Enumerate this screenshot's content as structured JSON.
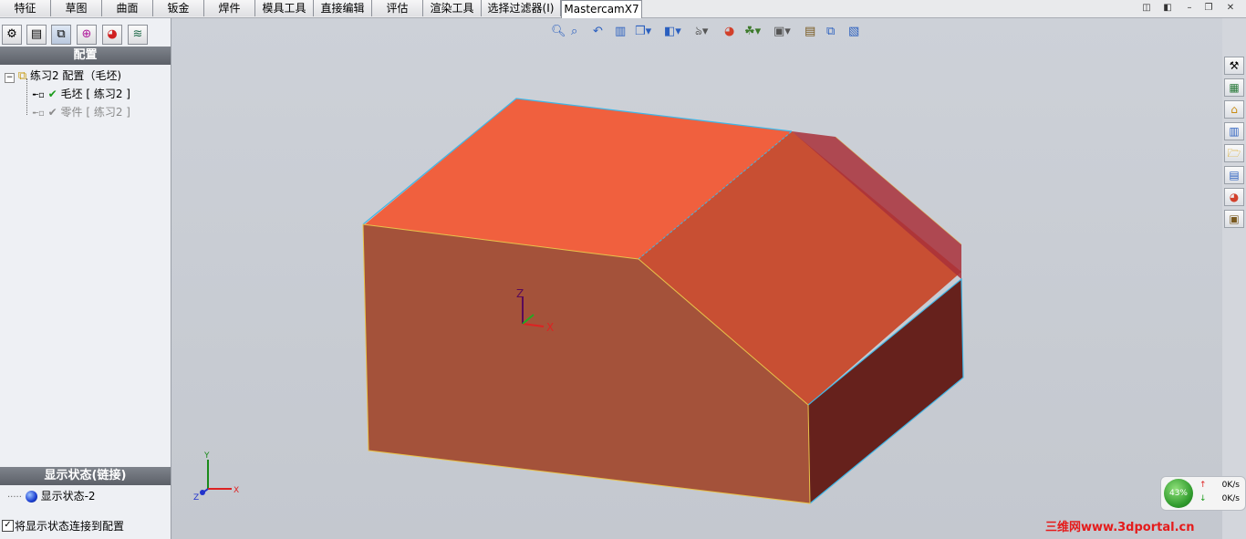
{
  "tabs": [
    {
      "label": "特征"
    },
    {
      "label": "草图"
    },
    {
      "label": "曲面"
    },
    {
      "label": "钣金"
    },
    {
      "label": "焊件"
    },
    {
      "label": "模具工具"
    },
    {
      "label": "直接编辑"
    },
    {
      "label": "评估"
    },
    {
      "label": "渲染工具"
    },
    {
      "label": "选择过滤器(I)"
    },
    {
      "label": "MastercamX7"
    }
  ],
  "active_tab": "MastercamX7",
  "config_panel": {
    "header": "配置",
    "root": "练习2 配置（毛坯)",
    "items": [
      {
        "label": "毛坯 [ 练习2 ]",
        "active": true
      },
      {
        "label": "零件 [ 练习2 ]",
        "active": false
      }
    ]
  },
  "display_panel": {
    "header": "显示状态(链接)",
    "item": "显示状态-2",
    "link_checkbox_label": "将显示状态连接到配置",
    "link_checked": true
  },
  "triad": {
    "x": "X",
    "y": "Y",
    "z": "Z"
  },
  "net_monitor": {
    "percent": "43%",
    "up": "0K/s",
    "down": "0K/s"
  },
  "watermark": "三维网www.3dportal.cn",
  "colors": {
    "part_top": "#f0603e",
    "part_front": "#a4523a",
    "part_side": "#66211c",
    "edge_highlight": "#3fb6e6"
  }
}
